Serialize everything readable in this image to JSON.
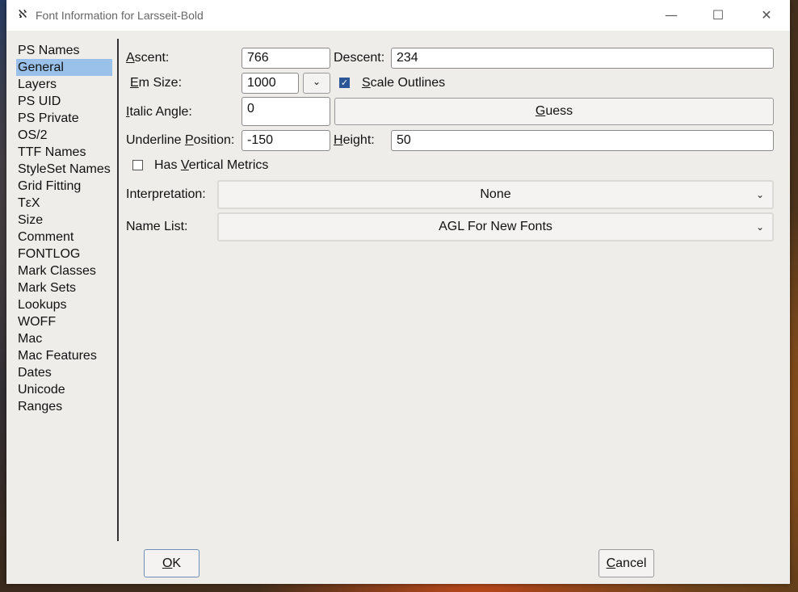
{
  "window": {
    "title": "Font Information for Larsseit-Bold",
    "icon": "fontforge-icon",
    "minimize_glyph": "—",
    "maximize_glyph": "☐",
    "close_glyph": "✕"
  },
  "nav": {
    "items": [
      {
        "label": "PS Names"
      },
      {
        "label": "General",
        "selected": true
      },
      {
        "label": "Layers"
      },
      {
        "label": "PS UID"
      },
      {
        "label": "PS Private"
      },
      {
        "label": "OS/2"
      },
      {
        "label": "TTF Names"
      },
      {
        "label": "StyleSet Names"
      },
      {
        "label": "Grid Fitting"
      },
      {
        "label": "TεX"
      },
      {
        "label": "Size"
      },
      {
        "label": "Comment"
      },
      {
        "label": "FONTLOG"
      },
      {
        "label": "Mark Classes"
      },
      {
        "label": "Mark Sets"
      },
      {
        "label": "Lookups"
      },
      {
        "label": "WOFF"
      },
      {
        "label": "Mac"
      },
      {
        "label": "Mac Features"
      },
      {
        "label": "Dates"
      },
      {
        "label": "Unicode Ranges"
      }
    ]
  },
  "general": {
    "ascent_label_ul": "A",
    "ascent_label_rest": "scent:",
    "ascent_value": "766",
    "descent_label": "Descent:",
    "descent_value": "234",
    "emsize_label_ul": "E",
    "emsize_label_rest": "m Size:",
    "emsize_value": "1000",
    "emsize_chevron": "⌄",
    "scale_outlines_checked": true,
    "scale_outlines_check_glyph": "✓",
    "scale_outlines_ul": "S",
    "scale_outlines_rest": "cale Outlines",
    "italic_label_ul": "I",
    "italic_label_rest": "talic Angle:",
    "italic_value": "0",
    "guess_ul": "G",
    "guess_rest": "uess",
    "underline_label_a": "Underline ",
    "underline_label_ul": "P",
    "underline_label_b": "osition:",
    "underline_value": "-150",
    "height_label_ul": "H",
    "height_label_rest": "eight:",
    "height_value": "50",
    "vertical_checked": false,
    "vertical_label_a": "Has ",
    "vertical_label_ul": "V",
    "vertical_label_b": "ertical Metrics",
    "interpretation_label": "Interpretation:",
    "interpretation_value": "None",
    "namelist_label": "Name List:",
    "namelist_value": "AGL For New Fonts",
    "dropdown_chevron": "⌄"
  },
  "footer": {
    "ok_ul": "O",
    "ok_rest": "K",
    "cancel_ul": "C",
    "cancel_rest": "ancel"
  }
}
